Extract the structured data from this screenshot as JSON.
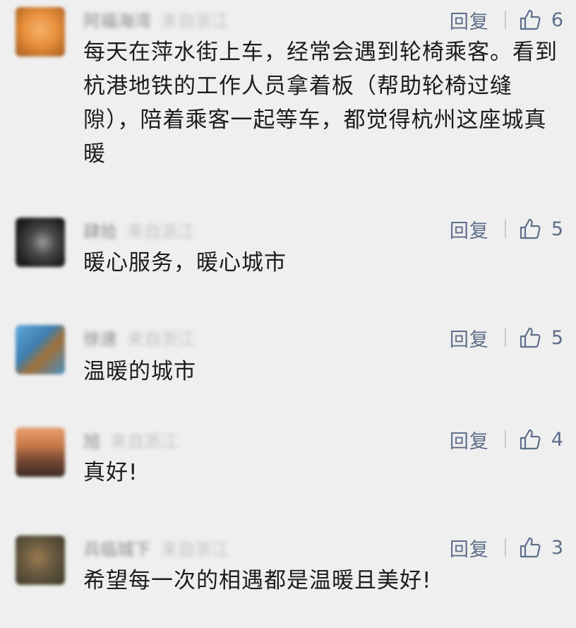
{
  "comments": [
    {
      "nickname": "阿福海湾",
      "location": "来自浙江",
      "reply_label": "回复",
      "likes": "6",
      "text": "每天在萍水街上车，经常会遇到轮椅乘客。看到杭港地铁的工作人员拿着板（帮助轮椅过缝隙），陪着乘客一起等车，都觉得杭州这座城真暖",
      "avatar_colors": [
        "#e8903c",
        "#a35a1f"
      ]
    },
    {
      "nickname": "肆拾",
      "location": "来自浙江",
      "reply_label": "回复",
      "likes": "5",
      "text": "暖心服务，暖心城市",
      "avatar_colors": [
        "#2a2a2a",
        "#8a8a8a"
      ]
    },
    {
      "nickname": "徐速",
      "location": "来自浙江",
      "reply_label": "回复",
      "likes": "5",
      "text": "温暖的城市",
      "avatar_colors": [
        "#4a8fc0",
        "#a0703a"
      ]
    },
    {
      "nickname": "旭",
      "location": "来自浙江",
      "reply_label": "回复",
      "likes": "4",
      "text": "真好!",
      "avatar_colors": [
        "#c97a4a",
        "#5a3a30"
      ]
    },
    {
      "nickname": "兵临城下",
      "location": "来自浙江",
      "reply_label": "回复",
      "likes": "3",
      "text": "希望每一次的相遇都是温暖且美好!",
      "avatar_colors": [
        "#6a5a40",
        "#3a3a2a"
      ]
    }
  ]
}
